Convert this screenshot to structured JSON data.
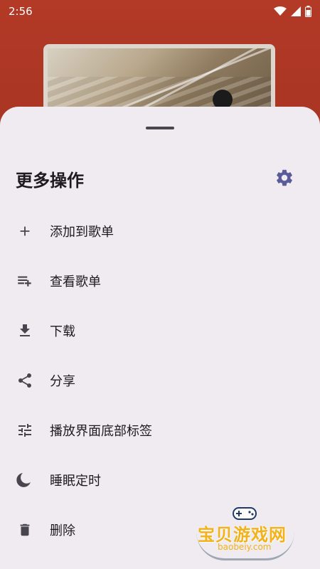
{
  "status": {
    "time": "2:56"
  },
  "sheet": {
    "title": "更多操作"
  },
  "menu": [
    {
      "label": "添加到歌单",
      "icon": "plus-icon"
    },
    {
      "label": "查看歌单",
      "icon": "playlist-add-icon"
    },
    {
      "label": "下载",
      "icon": "download-icon"
    },
    {
      "label": "分享",
      "icon": "share-icon"
    },
    {
      "label": "播放界面底部标签",
      "icon": "tune-icon"
    },
    {
      "label": "睡眠定时",
      "icon": "moon-icon"
    },
    {
      "label": "删除",
      "icon": "trash-icon"
    }
  ],
  "watermark": {
    "text": "宝贝游戏网",
    "url": "baobeiy.com"
  },
  "colors": {
    "accent": "#5b5a9a",
    "sheet": "#efebf1",
    "background": "#a3301f"
  }
}
